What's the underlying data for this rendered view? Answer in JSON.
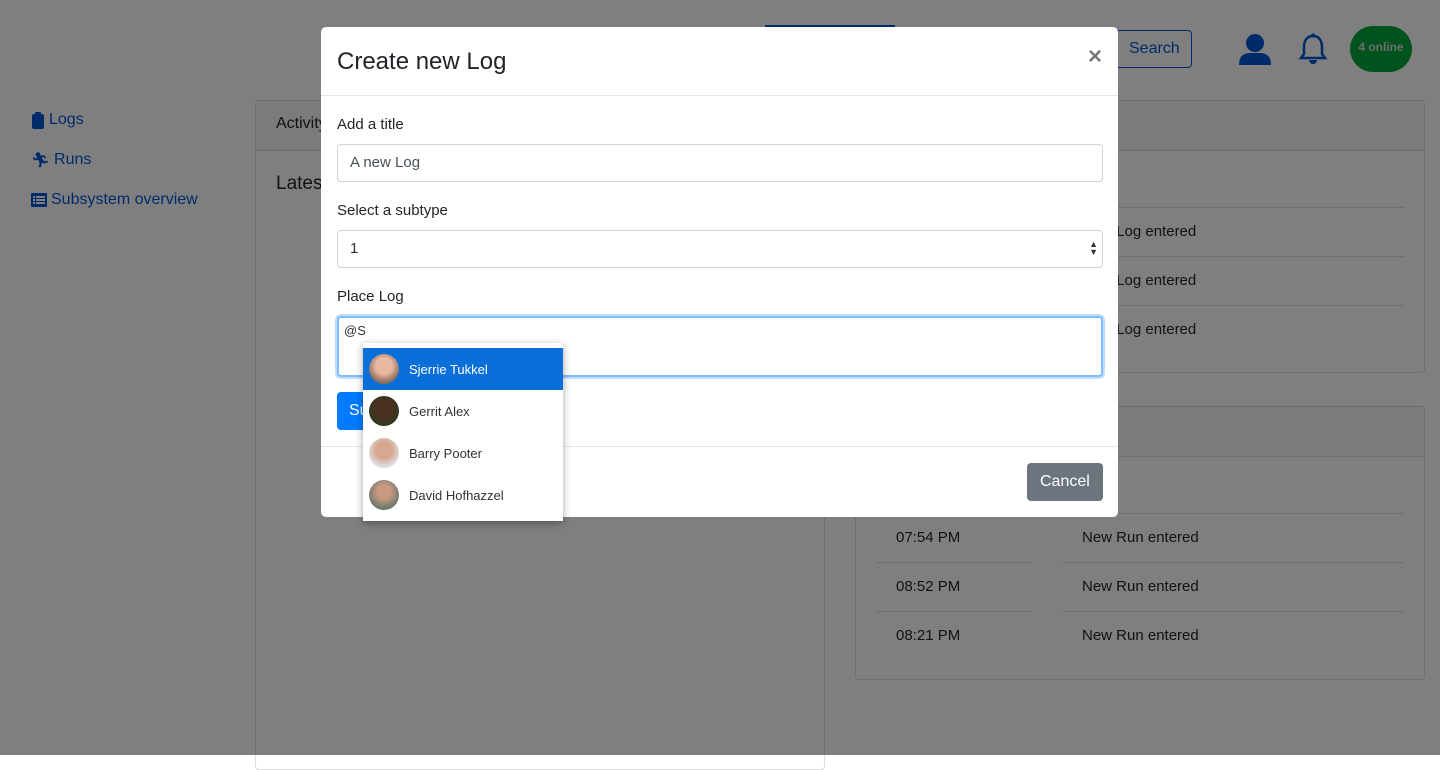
{
  "sidebar": {
    "items": [
      {
        "label": "Logs",
        "icon": "clipboard-icon"
      },
      {
        "label": "Runs",
        "icon": "running-icon"
      },
      {
        "label": "Subsystem overview",
        "icon": "list-icon"
      }
    ]
  },
  "header": {
    "search_label": "Search",
    "online_badge": "4 online",
    "colors": {
      "brand": "#0056d6",
      "online": "#00a63a"
    }
  },
  "main": {
    "activity_tab": "Activity",
    "latest_heading": "Latest",
    "log_rows": [
      {
        "desc": "New Log entered"
      },
      {
        "desc": "New Log entered"
      },
      {
        "desc": "New Log entered"
      }
    ],
    "run_rows": [
      {
        "time": "07:54 PM",
        "desc": "New Run entered"
      },
      {
        "time": "08:52 PM",
        "desc": "New Run entered"
      },
      {
        "time": "08:21 PM",
        "desc": "New Run entered"
      }
    ]
  },
  "modal": {
    "title": "Create new Log",
    "close": "×",
    "title_label": "Add a title",
    "title_value": "A new Log",
    "subtype_label": "Select a subtype",
    "subtype_value": "1",
    "place_label": "Place Log",
    "place_value": "@S",
    "submit": "Submit",
    "cancel": "Cancel",
    "mentions": [
      {
        "name": "Sjerrie Tukkel",
        "active": true
      },
      {
        "name": "Gerrit Alex"
      },
      {
        "name": "Barry Pooter"
      },
      {
        "name": "David Hofhazzel"
      }
    ]
  }
}
